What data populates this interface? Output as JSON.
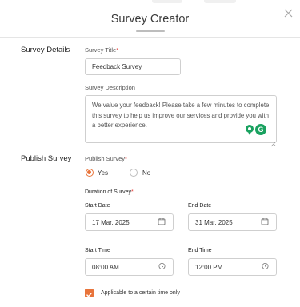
{
  "header": {
    "title": "Survey Creator"
  },
  "survey_details": {
    "section_label": "Survey Details",
    "title_label": "Survey Title",
    "title_value": "Feedback Survey",
    "description_label": "Survey Description",
    "description_value": "We value your feedback! Please take a few minutes to complete this survey to help us improve our services and provide you with a better experience.",
    "grammar_badge": "G"
  },
  "publish_survey": {
    "section_label": "Publish Survey",
    "publish_label": "Publish Survey",
    "options": [
      "Yes",
      "No"
    ],
    "selected": "Yes",
    "duration_label": "Duration of Survey",
    "start_date_label": "Start Date",
    "start_date_value": "17 Mar, 2025",
    "end_date_label": "End Date",
    "end_date_value": "31 Mar, 2025",
    "start_time_label": "Start Time",
    "start_time_value": "08:00 AM",
    "end_time_label": "End Time",
    "end_time_value": "12:00 PM",
    "time_only_label": "Applicable to a certain time only",
    "time_only_checked": true
  },
  "colors": {
    "accent": "#e8743b",
    "required": "#e53935",
    "grammar_green": "#1aa260"
  },
  "icons": [
    "close-icon",
    "calendar-icon",
    "clock-icon",
    "grammar-check-icon",
    "check-icon"
  ]
}
